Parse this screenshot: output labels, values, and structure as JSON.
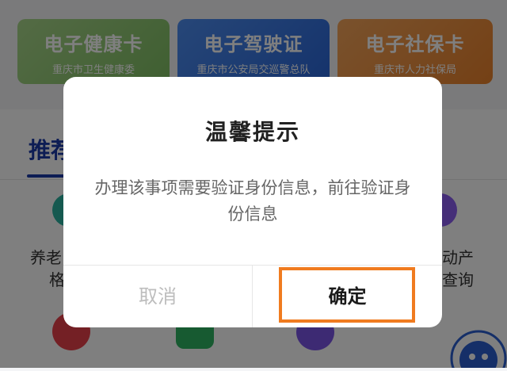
{
  "cards": [
    {
      "title": "电子健康卡",
      "subtitle": "重庆市卫生健康委"
    },
    {
      "title": "电子驾驶证",
      "subtitle": "重庆市公安局交巡警总队"
    },
    {
      "title": "电子社保卡",
      "subtitle": "重庆市人力社保局"
    }
  ],
  "recommend_tab": "推荐",
  "services": {
    "left_label_1": "养老",
    "left_label_2": "格",
    "right_label_1": "动产",
    "right_label_2": "查询"
  },
  "dialog": {
    "title": "温馨提示",
    "message": "办理该事项需要验证身份信息，前往验证身份信息",
    "cancel": "取消",
    "confirm": "确定"
  },
  "colors": {
    "highlight": "#f07b1f",
    "tab_active": "#1b3aa8",
    "health_card": "#8cc871",
    "driver_card": "#3a78e6",
    "social_card": "#ef9040"
  },
  "icons": [
    "service-icon-teal",
    "service-icon-purple",
    "service-icon-red",
    "service-icon-green",
    "service-icon-violet",
    "assistant-avatar-icon"
  ]
}
